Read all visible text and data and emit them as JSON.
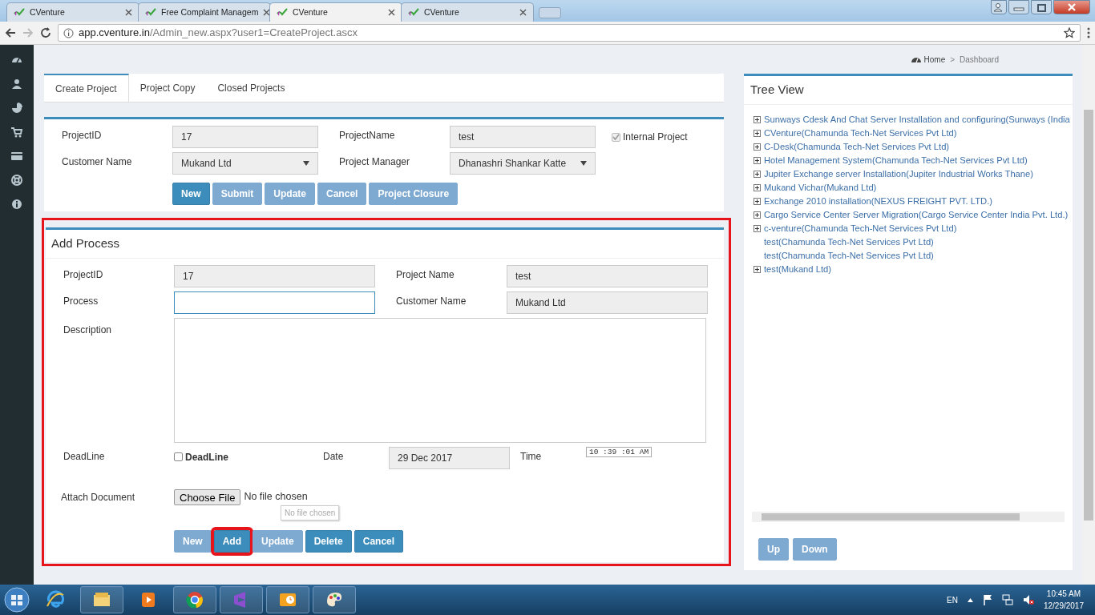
{
  "browser": {
    "tabs": [
      {
        "title": "CVenture",
        "selected": false
      },
      {
        "title": "Free Complaint Managem",
        "selected": false
      },
      {
        "title": "CVenture",
        "selected": true
      },
      {
        "title": "CVenture",
        "selected": false
      }
    ],
    "url_host": "app.cventure.in",
    "url_path": "/Admin_new.aspx?user1=CreateProject.ascx"
  },
  "breadcrumb": {
    "home": "Home",
    "separator": ">",
    "current": "Dashboard"
  },
  "project_tabs": [
    {
      "label": "Create Project",
      "selected": true
    },
    {
      "label": "Project Copy",
      "selected": false
    },
    {
      "label": "Closed Projects",
      "selected": false
    }
  ],
  "project_form": {
    "fields": [
      {
        "label": "ProjectID",
        "value": "17",
        "kind": "text",
        "disabled": true
      },
      {
        "label": "ProjectName",
        "value": "test",
        "kind": "text",
        "disabled": true
      },
      {
        "label": "Customer Name",
        "value": "Mukand Ltd",
        "kind": "select",
        "disabled": true
      },
      {
        "label": "Project Manager",
        "value": "Dhanashri Shankar Katte",
        "kind": "select",
        "disabled": true
      }
    ],
    "checkbox": {
      "label": "Internal Project",
      "checked": true,
      "disabled": true
    },
    "buttons": [
      {
        "label": "New",
        "disabled": false
      },
      {
        "label": "Submit",
        "disabled": true
      },
      {
        "label": "Update",
        "disabled": true
      },
      {
        "label": "Cancel",
        "disabled": true
      },
      {
        "label": "Project Closure",
        "disabled": true
      }
    ]
  },
  "add_process": {
    "title": "Add Process",
    "highlighted": true,
    "fields": [
      {
        "label": "ProjectID",
        "value": "17",
        "disabled": true,
        "focused": false
      },
      {
        "label": "Project Name",
        "value": "test",
        "disabled": true,
        "focused": false
      },
      {
        "label": "Process",
        "disabled": false,
        "focused": true
      },
      {
        "label": "Customer Name",
        "value": "Mukand Ltd",
        "disabled": true,
        "focused": false
      }
    ],
    "description_label": "Description",
    "deadline": {
      "label": "DeadLine",
      "checkbox_label": "DeadLine",
      "checked": false,
      "date_label": "Date",
      "date_value": "29 Dec 2017",
      "time_label": "Time",
      "time_value": "10 :39 :01 AM"
    },
    "attach": {
      "label": "Attach Document",
      "button": "Choose File",
      "status": "No file chosen",
      "tooltip": "No file chosen"
    },
    "buttons": [
      {
        "label": "New",
        "disabled": true,
        "highlighted": false
      },
      {
        "label": "Add",
        "disabled": false,
        "highlighted": true
      },
      {
        "label": "Update",
        "disabled": true,
        "highlighted": false
      },
      {
        "label": "Delete",
        "disabled": false,
        "highlighted": false
      },
      {
        "label": "Cancel",
        "disabled": false,
        "highlighted": false
      }
    ]
  },
  "tree_view": {
    "title": "Tree View",
    "items": [
      {
        "label": "Sunways Cdesk And Chat Server Installation and configuring(Sunways (India",
        "expandable": true
      },
      {
        "label": "CVenture(Chamunda Tech-Net Services Pvt Ltd)",
        "expandable": true
      },
      {
        "label": "C-Desk(Chamunda Tech-Net Services Pvt Ltd)",
        "expandable": true
      },
      {
        "label": "Hotel Management System(Chamunda Tech-Net Services Pvt Ltd)",
        "expandable": true
      },
      {
        "label": "Jupiter Exchange server Installation(Jupiter Industrial Works Thane)",
        "expandable": true
      },
      {
        "label": "Mukand Vichar(Mukand Ltd)",
        "expandable": true
      },
      {
        "label": "Exchange 2010 installation(NEXUS FREIGHT PVT. LTD.)",
        "expandable": true
      },
      {
        "label": "Cargo Service Center Server Migration(Cargo Service Center India Pvt. Ltd.)",
        "expandable": true
      },
      {
        "label": "c-venture(Chamunda Tech-Net Services Pvt Ltd)",
        "expandable": true
      },
      {
        "label": "test(Chamunda Tech-Net Services Pvt Ltd)",
        "expandable": false
      },
      {
        "label": "test(Chamunda Tech-Net Services Pvt Ltd)",
        "expandable": false
      },
      {
        "label": "test(Mukand Ltd)",
        "expandable": true
      }
    ],
    "buttons": [
      {
        "label": "Up"
      },
      {
        "label": "Down"
      }
    ]
  },
  "taskbar": {
    "language": "EN",
    "time": "10:45 AM",
    "date": "12/29/2017"
  }
}
